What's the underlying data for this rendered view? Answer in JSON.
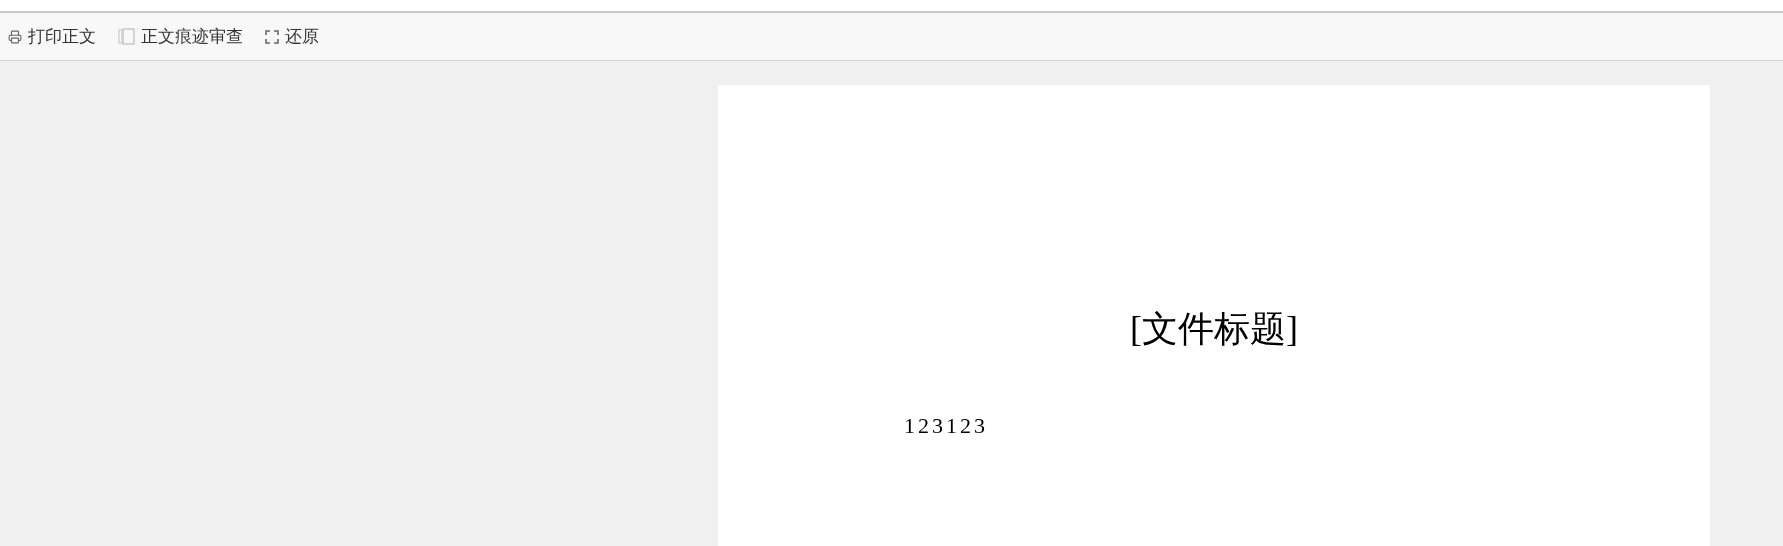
{
  "toolbar": [
    {
      "kind": "print",
      "label": "打印正文"
    },
    {
      "kind": "revision",
      "label": "正文痕迹审查"
    },
    {
      "kind": "restore",
      "label": "还原"
    }
  ],
  "document": {
    "title": "[文件标题]",
    "body": "123123"
  }
}
